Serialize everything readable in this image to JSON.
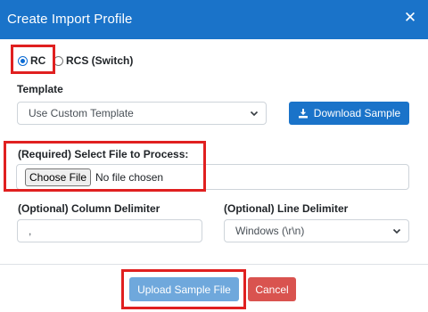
{
  "dialog": {
    "title": "Create Import Profile",
    "close_icon": "close-icon"
  },
  "profile_type": {
    "options": [
      {
        "label": "RC",
        "selected": true
      },
      {
        "label": "RCS (Switch)",
        "selected": false
      }
    ]
  },
  "template": {
    "label": "Template",
    "selected": "Use Custom Template",
    "download_button": "Download Sample",
    "download_icon": "download-icon"
  },
  "file": {
    "label": "(Required) Select File to Process:",
    "choose_button": "Choose File",
    "status": "No file chosen"
  },
  "column_delimiter": {
    "label": "(Optional) Column Delimiter",
    "value": ","
  },
  "line_delimiter": {
    "label": "(Optional) Line Delimiter",
    "selected": "Windows (\\r\\n)"
  },
  "footer": {
    "upload_button": "Upload Sample File",
    "cancel_button": "Cancel"
  },
  "colors": {
    "header_bg": "#1a73c9",
    "primary": "#1a73c9",
    "upload_bg": "#6fa8dc",
    "cancel_bg": "#d9534f",
    "highlight": "#e02020"
  }
}
